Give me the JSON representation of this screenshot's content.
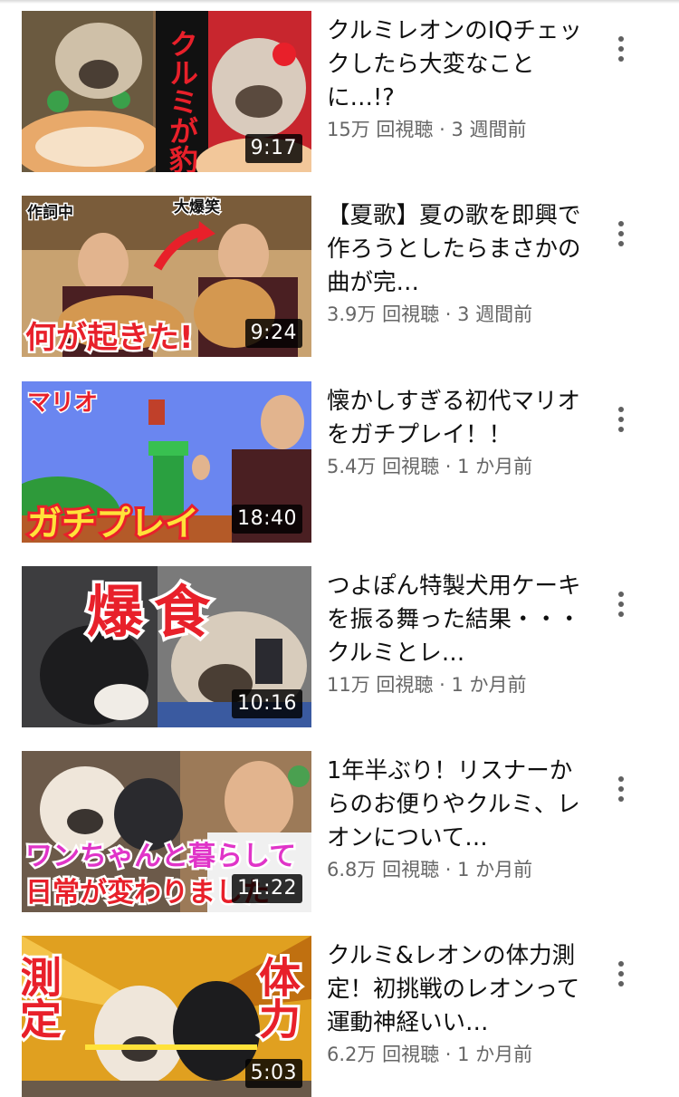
{
  "videos": [
    {
      "title": "クルミレオンのIQチェックしたら大変なことに…!?",
      "views": "15万 回視聴",
      "separator": "·",
      "age": "3 週間前",
      "duration": "9:17",
      "thumb_text": [
        "クルミが豹変"
      ]
    },
    {
      "title": "【夏歌】夏の歌を即興で作ろうとしたらまさかの曲が完…",
      "views": "3.9万 回視聴",
      "separator": "·",
      "age": "3 週間前",
      "duration": "9:24",
      "thumb_text": [
        "作詞中",
        "大爆笑",
        "何が起きた!"
      ]
    },
    {
      "title": "懐かしすぎる初代マリオをガチプレイ！！",
      "views": "5.4万 回視聴",
      "separator": "·",
      "age": "1 か月前",
      "duration": "18:40",
      "thumb_text": [
        "マリオ",
        "ガチプレイ"
      ]
    },
    {
      "title": "つよぽん特製犬用ケーキを振る舞った結果・・・クルミとレ…",
      "views": "11万 回視聴",
      "separator": "·",
      "age": "1 か月前",
      "duration": "10:16",
      "thumb_text": [
        "爆食"
      ]
    },
    {
      "title": "1年半ぶり！リスナーからのお便りやクルミ、レオンについて…",
      "views": "6.8万 回視聴",
      "separator": "·",
      "age": "1 か月前",
      "duration": "11:22",
      "thumb_text": [
        "ワンちゃんと暮らして",
        "日常が変わりました"
      ]
    },
    {
      "title": "クルミ&レオンの体力測定！初挑戦のレオンって運動神経いい…",
      "views": "6.2万 回視聴",
      "separator": "·",
      "age": "1 か月前",
      "duration": "5:03",
      "thumb_text": [
        "測定",
        "体力"
      ]
    }
  ],
  "colors": {
    "title": "#0f0f0f",
    "subtitle": "#666666",
    "overlay_red": "#e8202a",
    "overlay_yellow": "#ffe23a",
    "overlay_magenta": "#e034c8"
  },
  "icons": {
    "more": "more-vertical-icon"
  }
}
